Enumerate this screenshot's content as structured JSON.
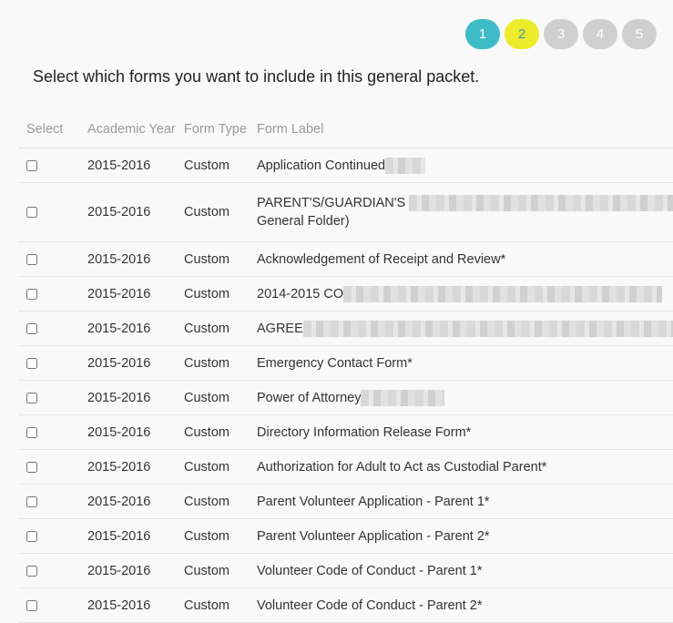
{
  "steps": [
    "1",
    "2",
    "3",
    "4",
    "5"
  ],
  "instructions": "Select which forms you want to include in this general packet.",
  "table": {
    "headers": {
      "select": "Select",
      "academic_year": "Academic Year",
      "form_type": "Form Type",
      "form_label": "Form Label"
    },
    "rows": [
      {
        "year": "2015-2016",
        "type": "Custom",
        "label": "Application Continued",
        "redacted": true
      },
      {
        "year": "2015-2016",
        "type": "Custom",
        "label": "PARENT'S/GUARDIAN'S",
        "label2": "General Folder)",
        "redacted": true
      },
      {
        "year": "2015-2016",
        "type": "Custom",
        "label": "Acknowledgement of Receipt and Review*"
      },
      {
        "year": "2015-2016",
        "type": "Custom",
        "label": "2014-2015 CO",
        "redacted": true
      },
      {
        "year": "2015-2016",
        "type": "Custom",
        "label": "AGREE",
        "redacted": true
      },
      {
        "year": "2015-2016",
        "type": "Custom",
        "label": "Emergency Contact Form*"
      },
      {
        "year": "2015-2016",
        "type": "Custom",
        "label": "Power of Attorney",
        "redacted": true
      },
      {
        "year": "2015-2016",
        "type": "Custom",
        "label": "Directory Information Release Form*"
      },
      {
        "year": "2015-2016",
        "type": "Custom",
        "label": "Authorization for Adult to Act as Custodial Parent*"
      },
      {
        "year": "2015-2016",
        "type": "Custom",
        "label": "Parent Volunteer Application - Parent 1*"
      },
      {
        "year": "2015-2016",
        "type": "Custom",
        "label": "Parent Volunteer Application - Parent 2*"
      },
      {
        "year": "2015-2016",
        "type": "Custom",
        "label": "Volunteer Code of Conduct - Parent 1*"
      },
      {
        "year": "2015-2016",
        "type": "Custom",
        "label": "Volunteer Code of Conduct - Parent 2*"
      }
    ]
  }
}
